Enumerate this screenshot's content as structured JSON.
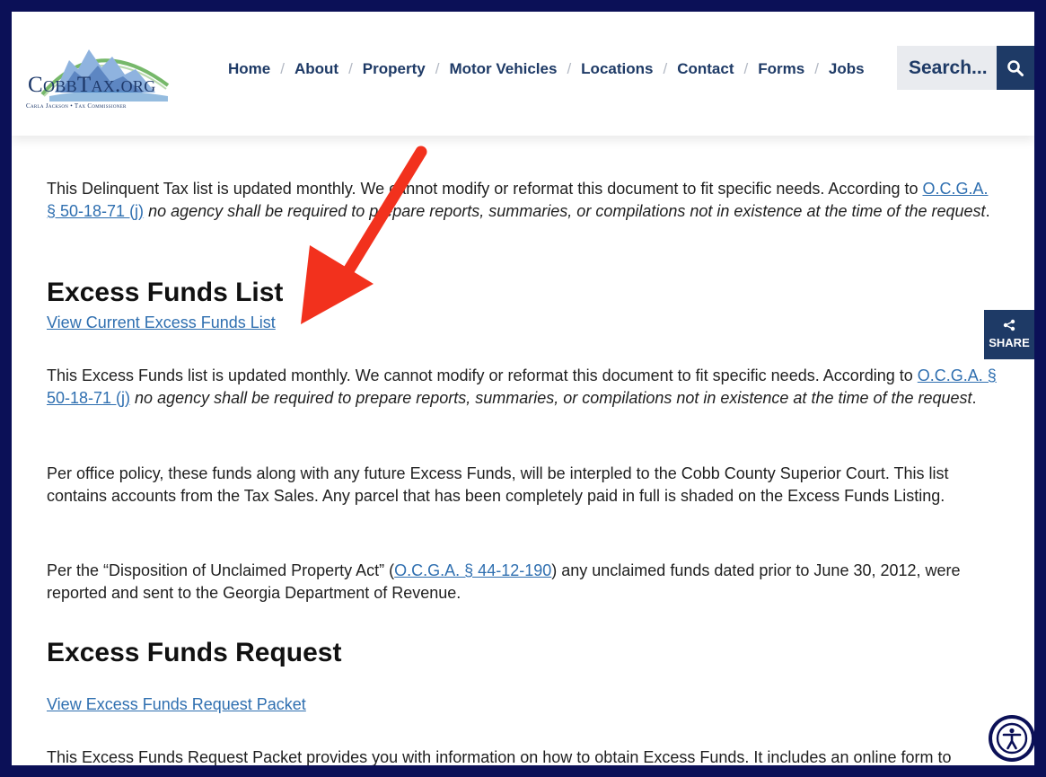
{
  "logo": {
    "name": "CobbTax.org",
    "tagline": "Carla Jackson • Tax Commissioner"
  },
  "nav": {
    "items": [
      {
        "label": "Home"
      },
      {
        "label": "About"
      },
      {
        "label": "Property"
      },
      {
        "label": "Motor Vehicles"
      },
      {
        "label": "Locations"
      },
      {
        "label": "Contact"
      },
      {
        "label": "Forms"
      },
      {
        "label": "Jobs"
      }
    ],
    "separator": "/"
  },
  "search": {
    "placeholder": "Search..."
  },
  "content": {
    "delinquent_paragraph": {
      "text": "This Delinquent Tax list is updated monthly. We cannot modify or reformat this document to fit specific needs. According to ",
      "link": "O.C.G.A. § 50-18-71 (j)",
      "italic": " no agency shall be required to prepare reports, summaries, or compilations not in existence at the time of the request",
      "end": "."
    },
    "excess_list_heading": "Excess Funds List",
    "excess_list_link": "View Current Excess Funds List",
    "excess_list_paragraph": {
      "text": "This Excess Funds list is updated monthly. We cannot modify or reformat this document to fit specific needs. According to ",
      "link": "O.C.G.A. § 50-18-71 (j)",
      "italic": " no agency shall be required to prepare reports, summaries, or compilations not in existence at the time of the request",
      "end": "."
    },
    "policy_paragraph": "Per office policy, these funds along with any future Excess Funds, will be interpled to the Cobb County Superior Court. This list contains accounts from the Tax Sales. Any parcel that has been completely paid in full is shaded on the Excess Funds Listing.",
    "disposition_paragraph": {
      "before": "Per the “Disposition of Unclaimed Property Act” (",
      "link": "O.C.G.A. § 44-12-190",
      "after": ") any unclaimed funds dated prior to June 30, 2012, were reported and sent to the Georgia Department of Revenue."
    },
    "request_heading": "Excess Funds Request",
    "request_link": "View Excess Funds Request Packet",
    "request_paragraph": "This Excess Funds Request Packet provides you with information on how to obtain Excess Funds. It includes an online form to submit your excess funds request."
  },
  "share": {
    "label": "SHARE"
  },
  "colors": {
    "navy": "#1e3a66",
    "border": "#0b1057",
    "link": "#2f6fb0",
    "arrow": "#f2311d"
  }
}
